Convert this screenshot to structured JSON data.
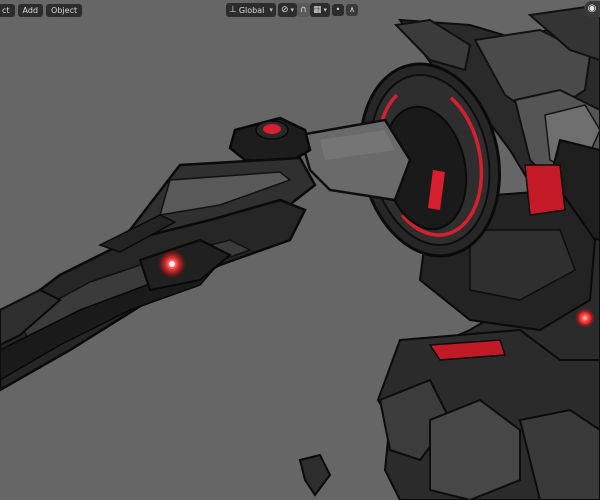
{
  "header": {
    "menu": [
      {
        "label": "ct"
      },
      {
        "label": "Add"
      },
      {
        "label": "Object"
      }
    ],
    "transform_orientation": {
      "value": "Global"
    },
    "icons": {
      "orientation": "axes-icon",
      "snap": "snap-magnet-icon",
      "snap_target": "grid-snap-icon",
      "proportional": "proportional-edit-icon",
      "falloff": "falloff-curve-icon",
      "pivot": "pivot-point-icon",
      "overlay_eye": "eye-visibility-icon"
    }
  },
  "colors": {
    "accent_red": "#d81f2f",
    "glow": "#ff4040",
    "panel_bg": "#2c2c2c",
    "viewport_bg": "#666666"
  }
}
